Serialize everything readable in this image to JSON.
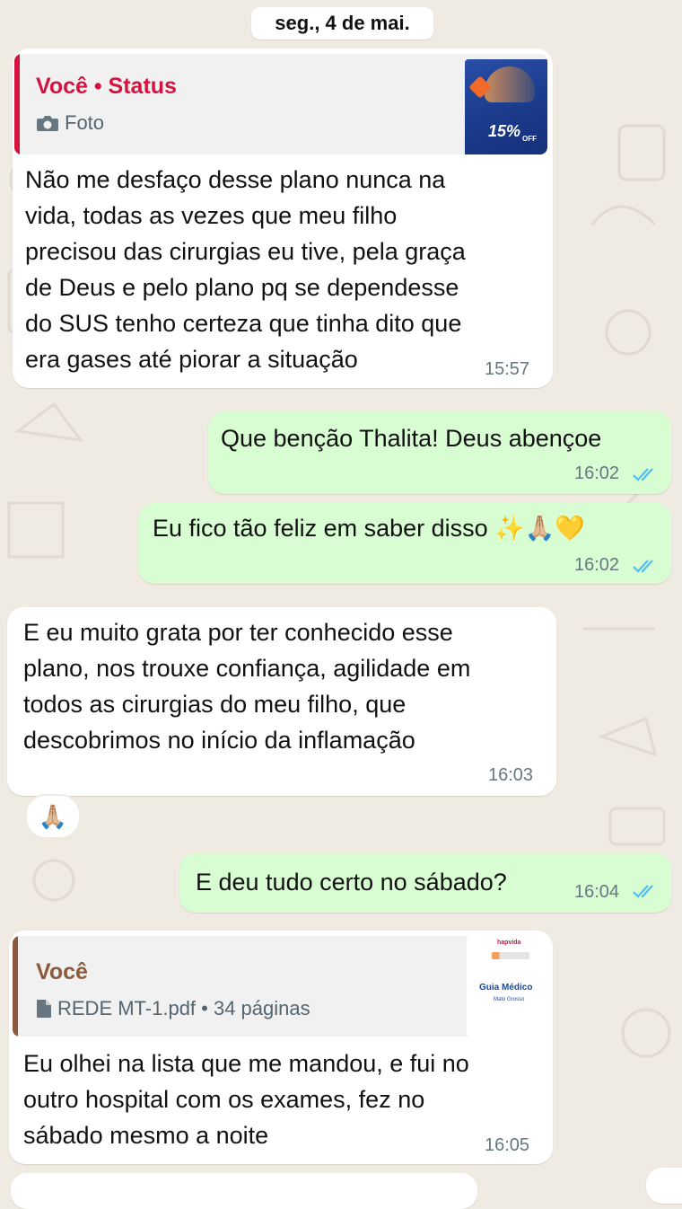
{
  "date_separator": "seg., 4 de mai.",
  "messages": [
    {
      "direction": "incoming",
      "quote": {
        "author": "Você • Status",
        "subtitle": "Foto",
        "icon": "camera-icon",
        "thumb_badge": "15%",
        "thumb_badge_sub": "OFF"
      },
      "text": "Não me desfaço desse plano nunca na\nvida, todas as vezes que meu filho\nprecisou das cirurgias eu tive, pela graça\nde Deus e pelo plano pq se dependesse\ndo SUS tenho certeza que tinha dito que\nera gases até piorar a situação",
      "time": "15:57"
    },
    {
      "direction": "outgoing",
      "text": "Que benção Thalita! Deus abençoe",
      "time": "16:02",
      "status": "read"
    },
    {
      "direction": "outgoing",
      "text": "Eu fico tão feliz em saber disso ✨🙏🏼💛",
      "time": "16:02",
      "status": "read"
    },
    {
      "direction": "incoming",
      "text": "E eu muito grata por ter conhecido esse\nplano, nos trouxe confiança, agilidade em\ntodos as cirurgias do meu filho, que\ndescobrimos no início da inflamação",
      "time": "16:03",
      "reaction": "🙏🏼"
    },
    {
      "direction": "outgoing",
      "text": "E deu tudo certo no sábado?",
      "time": "16:04",
      "status": "read"
    },
    {
      "direction": "incoming",
      "quote": {
        "author": "Você",
        "subtitle": "REDE MT-1.pdf • 34 páginas",
        "icon": "document-icon",
        "thumb_title": "Guia Médico",
        "thumb_sub": "Mato Grosso",
        "thumb_brand": "hapvida"
      },
      "text": "Eu olhei na lista que me mandou, e fui no\noutro hospital com os exames, fez no\nsábado mesmo a noite",
      "time": "16:05"
    }
  ],
  "colors": {
    "background": "#efeae2",
    "incoming_bubble": "#ffffff",
    "outgoing_bubble": "#d9fdd3",
    "read_ticks": "#53bdeb",
    "quote_status_accent": "#d4143f",
    "quote_doc_accent": "#8b5a3c"
  }
}
